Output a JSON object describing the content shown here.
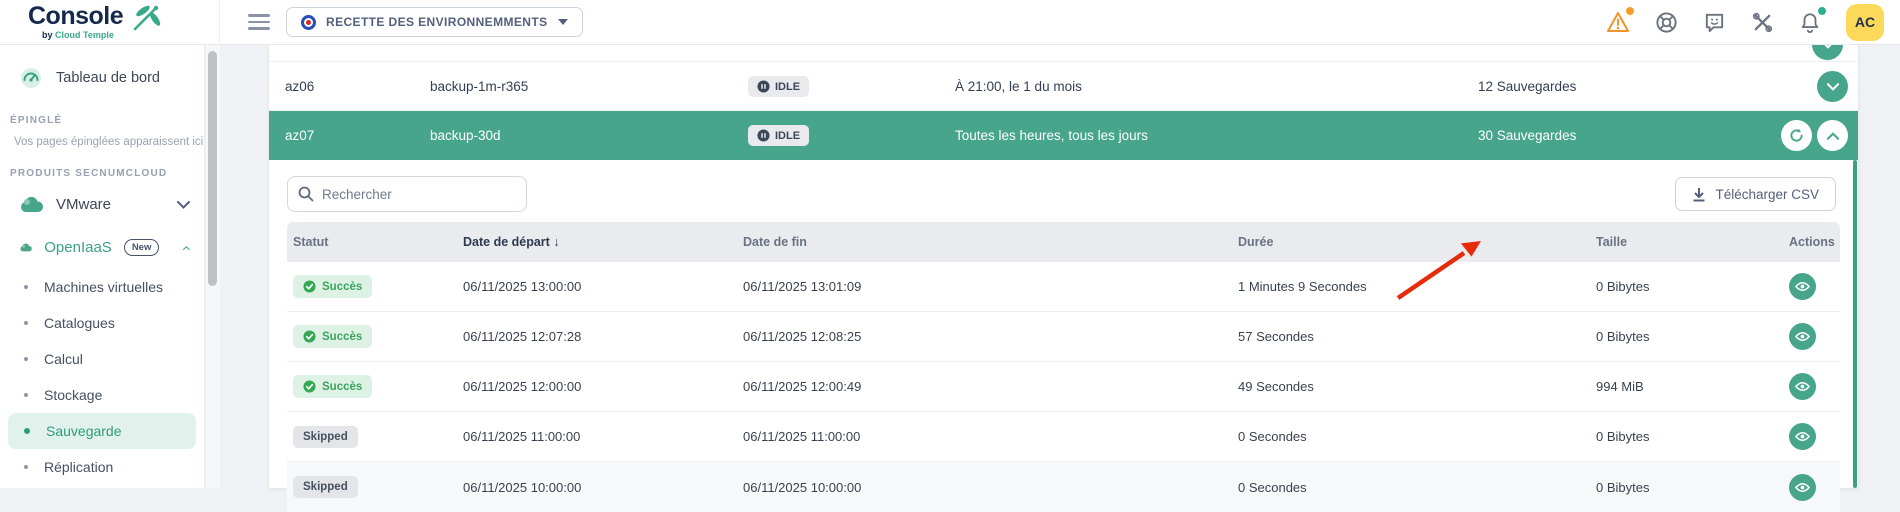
{
  "topbar": {
    "logo": {
      "title": "Console",
      "byline_prefix": "by",
      "byline_brand": "Cloud Temple"
    },
    "env_selector": {
      "label": "RECETTE DES ENVIRONNEMMENTS"
    },
    "icons": [
      "warning-triangle-icon",
      "lifebuoy-icon",
      "feedback-icon",
      "tools-icon",
      "bell-icon"
    ],
    "avatar_initials": "AC"
  },
  "sidebar": {
    "dashboard_label": "Tableau de bord",
    "pinned_section_label": "ÉPINGLÉ",
    "pinned_empty_hint": "Vos pages épinglées apparaissent ici",
    "products_section_label": "PRODUITS SECNUMCLOUD",
    "products": [
      {
        "label": "VMware",
        "expanded": false
      },
      {
        "label": "OpenIaaS",
        "badge": "New",
        "expanded": true
      }
    ],
    "openiaas_items": [
      "Machines virtuelles",
      "Catalogues",
      "Calcul",
      "Stockage",
      "Sauvegarde",
      "Réplication"
    ],
    "active_item": "Sauvegarde"
  },
  "policies": {
    "rows": [
      {
        "name": "az06",
        "job": "backup-1m-r365",
        "state": "IDLE",
        "schedule": "À 21:00, le 1 du mois",
        "count": "12 Sauvegardes",
        "selected": false
      },
      {
        "name": "az07",
        "job": "backup-30d",
        "state": "IDLE",
        "schedule": "Toutes les heures, tous les jours",
        "count": "30 Sauvegardes",
        "selected": true
      }
    ]
  },
  "panel": {
    "search_placeholder": "Rechercher",
    "download_csv_label": "Télécharger CSV",
    "table": {
      "headers": [
        "Statut",
        "Date de départ",
        "Date de fin",
        "Durée",
        "Taille",
        "Actions"
      ],
      "sort_column": "Date de départ",
      "sort_direction": "desc",
      "rows": [
        {
          "statut": "Succès",
          "type": "success",
          "start": "06/11/2025 13:00:00",
          "end": "06/11/2025 13:01:09",
          "duree": "1 Minutes 9 Secondes",
          "taille": "0 Bibytes"
        },
        {
          "statut": "Succès",
          "type": "success",
          "start": "06/11/2025 12:07:28",
          "end": "06/11/2025 12:08:25",
          "duree": "57 Secondes",
          "taille": "0 Bibytes"
        },
        {
          "statut": "Succès",
          "type": "success",
          "start": "06/11/2025 12:00:00",
          "end": "06/11/2025 12:00:49",
          "duree": "49 Secondes",
          "taille": "994 MiB"
        },
        {
          "statut": "Skipped",
          "type": "skipped",
          "start": "06/11/2025 11:00:00",
          "end": "06/11/2025 11:00:00",
          "duree": "0 Secondes",
          "taille": "0 Bibytes"
        },
        {
          "statut": "Skipped",
          "type": "skipped",
          "start": "06/11/2025 10:00:00",
          "end": "06/11/2025 10:00:00",
          "duree": "0 Secondes",
          "taille": "0 Bibytes"
        }
      ]
    }
  },
  "colors": {
    "accent_teal": "#46a58a",
    "selected_row_bg": "#46a58a",
    "success_badge_bg": "#ddf2e4",
    "success_badge_text": "#3da45f",
    "skipped_badge_bg": "#e3e5e9",
    "warning_orange": "#f0942c",
    "avatar_yellow": "#fcd95b",
    "logo_navy": "#16294d",
    "annotation_red": "#e62b0d"
  }
}
